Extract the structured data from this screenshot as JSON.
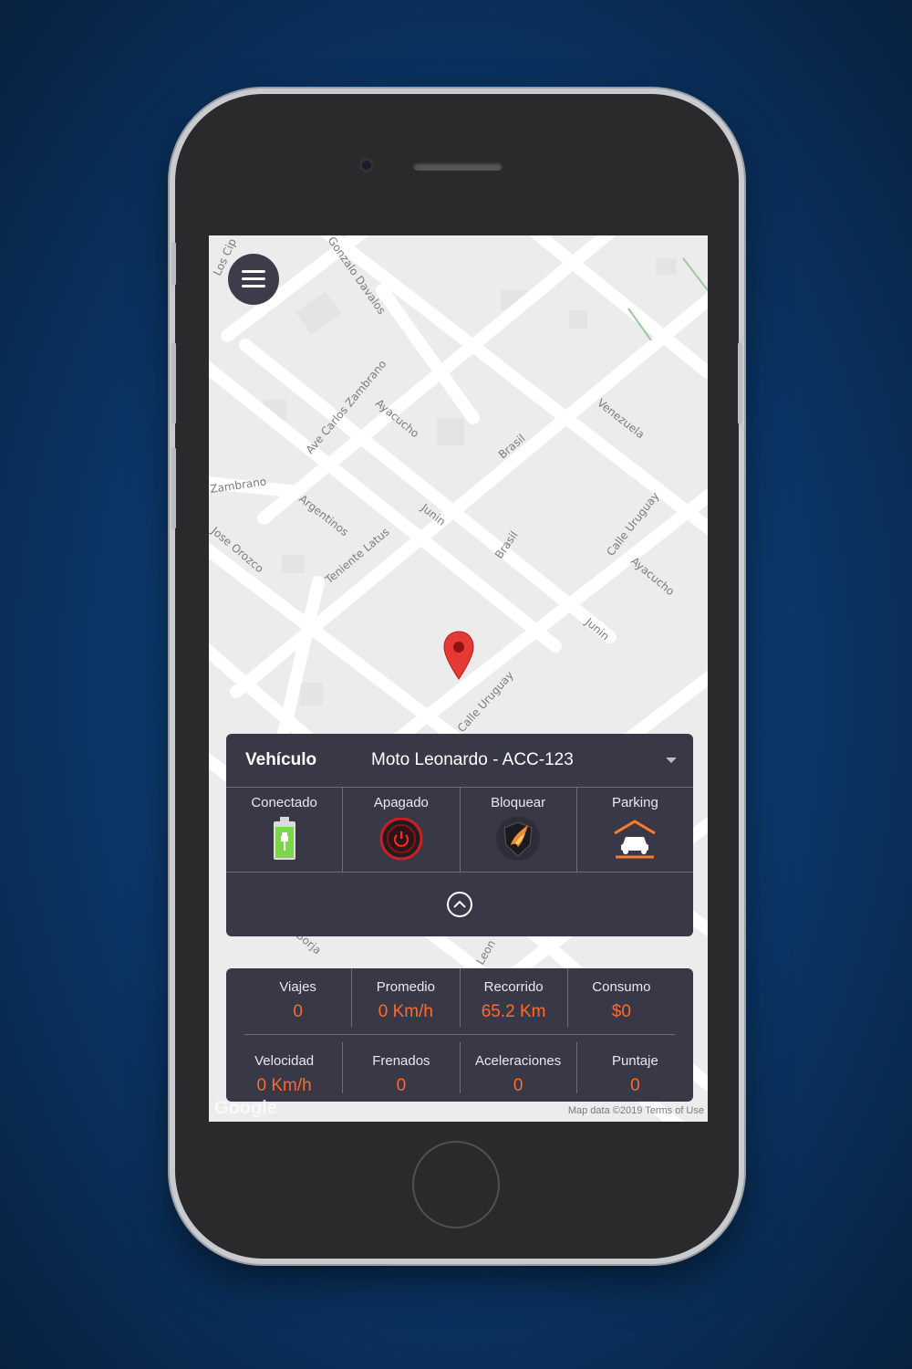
{
  "map": {
    "streets": [
      "Los Cip",
      "Gonzalo Davalos",
      "Ave Carlos Zambrano",
      "Ayacucho",
      "Brasil",
      "Venezuela",
      "Zambrano",
      "Argentinos",
      "Junin",
      "Jose Orozco",
      "Teniente Latus",
      "Brasil",
      "Calle Uruguay",
      "Ayacucho",
      "Junin",
      "Calle Uruguay",
      "Borja",
      "Leon"
    ],
    "google_label": "Google",
    "map_data_text": "Map data ©2019   Terms of Use"
  },
  "vehicle": {
    "label": "Vehículo",
    "selected": "Moto Leonardo - ACC-123",
    "actions": [
      {
        "label": "Conectado",
        "icon": "battery-plug-icon"
      },
      {
        "label": "Apagado",
        "icon": "power-icon"
      },
      {
        "label": "Bloquear",
        "icon": "shield-flame-icon"
      },
      {
        "label": "Parking",
        "icon": "garage-car-icon"
      }
    ]
  },
  "stats": {
    "row1": [
      {
        "label": "Viajes",
        "value": "0"
      },
      {
        "label": "Promedio",
        "value": "0 Km/h"
      },
      {
        "label": "Recorrido",
        "value": "65.2 Km"
      },
      {
        "label": "Consumo",
        "value": "$0"
      }
    ],
    "row2": [
      {
        "label": "Velocidad",
        "value": "0 Km/h"
      },
      {
        "label": "Frenados",
        "value": "0"
      },
      {
        "label": "Aceleraciones",
        "value": "0"
      },
      {
        "label": "Puntaje",
        "value": "0"
      }
    ]
  },
  "colors": {
    "accent": "#ff6a2a",
    "panel": "#393846",
    "pin": "#e53935",
    "battery": "#7bd64a"
  }
}
